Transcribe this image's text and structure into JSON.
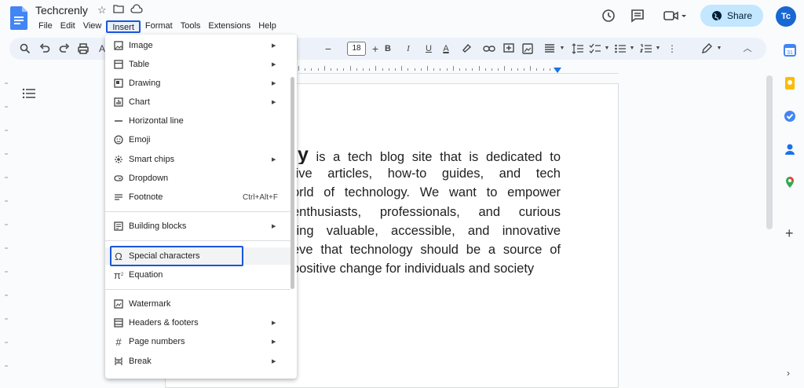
{
  "doc": {
    "title": "Techcrenly"
  },
  "menubar": [
    "File",
    "Edit",
    "View",
    "Insert",
    "Format",
    "Tools",
    "Extensions",
    "Help"
  ],
  "header": {
    "share_label": "Share",
    "avatar_initials": "Tc"
  },
  "toolbar": {
    "font_size": "18"
  },
  "insert_menu": {
    "items": [
      {
        "label": "Image",
        "icon": "image-icon",
        "submenu": true
      },
      {
        "label": "Table",
        "icon": "table-icon",
        "submenu": true
      },
      {
        "label": "Drawing",
        "icon": "drawing-icon",
        "submenu": true
      },
      {
        "label": "Chart",
        "icon": "chart-icon",
        "submenu": true
      },
      {
        "label": "Horizontal line",
        "icon": "horizontal-line-icon",
        "submenu": false
      },
      {
        "label": "Emoji",
        "icon": "emoji-icon",
        "submenu": false
      },
      {
        "label": "Smart chips",
        "icon": "smart-chips-icon",
        "submenu": true
      },
      {
        "label": "Dropdown",
        "icon": "dropdown-icon",
        "submenu": false
      },
      {
        "label": "Footnote",
        "icon": "footnote-icon",
        "submenu": false,
        "shortcut": "Ctrl+Alt+F"
      },
      {
        "label": "Building blocks",
        "icon": "building-blocks-icon",
        "submenu": true
      },
      {
        "label": "Special characters",
        "icon": "omega-icon",
        "submenu": false
      },
      {
        "label": "Equation",
        "icon": "pi-icon",
        "submenu": false
      },
      {
        "label": "Watermark",
        "icon": "watermark-icon",
        "submenu": false
      },
      {
        "label": "Headers & footers",
        "icon": "headers-footers-icon",
        "submenu": true
      },
      {
        "label": "Page numbers",
        "icon": "page-numbers-icon",
        "submenu": true
      },
      {
        "label": "Break",
        "icon": "break-icon",
        "submenu": true
      }
    ]
  },
  "document_body": {
    "lines": [
      {
        "bold": "ly",
        "rest": " is a tech blog site that is dedicated to"
      },
      {
        "bold": "",
        "rest": "tive articles, how-to guides, and tech"
      },
      {
        "bold": "",
        "rest": "orld of technology. We want to empower"
      },
      {
        "bold": "",
        "rest": " enthusiasts, professionals, and curious"
      },
      {
        "bold": "",
        "rest": "ring valuable, accessible, and innovative"
      },
      {
        "bold": "",
        "rest": "eve that technology should be a source of"
      },
      {
        "bold": "",
        "rest": "positive change for individuals and society"
      }
    ]
  },
  "colors": {
    "accent": "#1a56db",
    "share_bg": "#c2e7ff",
    "docs_blue": "#4285f4"
  }
}
